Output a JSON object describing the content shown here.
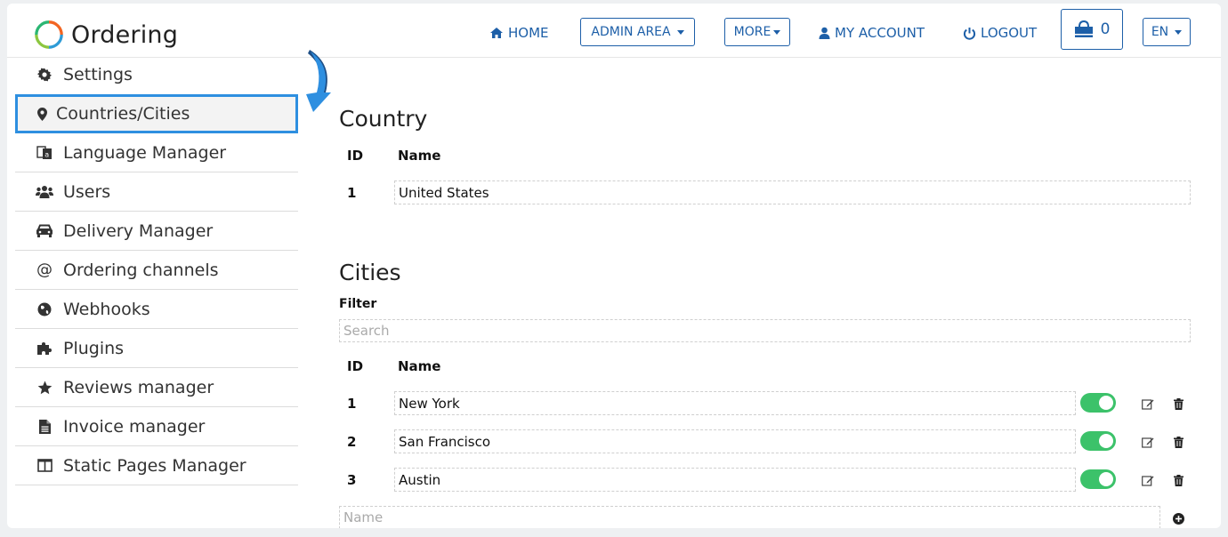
{
  "brand": {
    "name": "Ordering",
    "logo_icon": "ordering-ring-logo"
  },
  "nav": {
    "home": "HOME",
    "admin_area": "ADMIN AREA",
    "more": "MORE",
    "my_account": "MY ACCOUNT",
    "logout": "LOGOUT",
    "cart_count": "0",
    "language": "EN"
  },
  "sidebar": {
    "items": [
      {
        "label": "Settings",
        "icon": "gear-icon"
      },
      {
        "label": "Countries/Cities",
        "icon": "map-marker-icon",
        "active": true
      },
      {
        "label": "Language Manager",
        "icon": "language-icon"
      },
      {
        "label": "Users",
        "icon": "users-icon"
      },
      {
        "label": "Delivery Manager",
        "icon": "car-icon"
      },
      {
        "label": "Ordering channels",
        "icon": "at-icon"
      },
      {
        "label": "Webhooks",
        "icon": "globe-icon"
      },
      {
        "label": "Plugins",
        "icon": "puzzle-icon"
      },
      {
        "label": "Reviews manager",
        "icon": "star-icon"
      },
      {
        "label": "Invoice manager",
        "icon": "file-icon"
      },
      {
        "label": "Static Pages Manager",
        "icon": "columns-icon"
      }
    ]
  },
  "country": {
    "title": "Country",
    "col_id": "ID",
    "col_name": "Name",
    "rows": [
      {
        "id": "1",
        "name": "United States"
      }
    ]
  },
  "cities": {
    "title": "Cities",
    "filter_label": "Filter",
    "search_placeholder": "Search",
    "col_id": "ID",
    "col_name": "Name",
    "rows": [
      {
        "id": "1",
        "name": "New York",
        "enabled": true
      },
      {
        "id": "2",
        "name": "San Francisco",
        "enabled": true
      },
      {
        "id": "3",
        "name": "Austin",
        "enabled": true
      }
    ],
    "new_name_placeholder": "Name"
  },
  "colors": {
    "accent": "#1d5fa8",
    "highlight": "#2e8fe0",
    "toggle_on": "#3cc26a"
  }
}
